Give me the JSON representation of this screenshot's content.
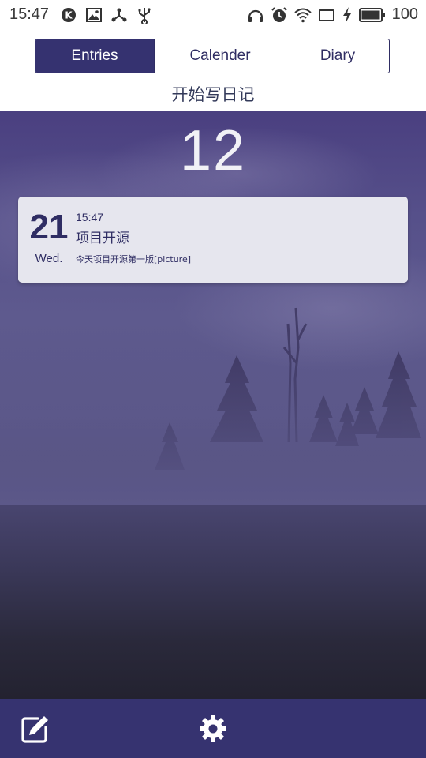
{
  "status_bar": {
    "time": "15:47",
    "battery": "100",
    "left_icons": [
      "k-app-icon",
      "image-icon",
      "share-icon",
      "usb-icon"
    ],
    "right_icons": [
      "headset-icon",
      "alarm-icon",
      "wifi-icon",
      "screen-icon",
      "charging-icon",
      "battery-icon"
    ]
  },
  "tabs": [
    {
      "label": "Entries",
      "active": true
    },
    {
      "label": "Calender",
      "active": false
    },
    {
      "label": "Diary",
      "active": false
    }
  ],
  "subtitle": "开始写日记",
  "month": "12",
  "entries": [
    {
      "day": "21",
      "weekday": "Wed.",
      "time": "15:47",
      "title": "项目开源",
      "summary": "今天项目开源第一版[picture]"
    }
  ],
  "bottom_bar": {
    "edit_icon": "edit-icon",
    "settings_icon": "gear-icon"
  },
  "colors": {
    "primary": "#353270",
    "card": "#e6e6ee",
    "text_accent": "#2f2d63"
  }
}
